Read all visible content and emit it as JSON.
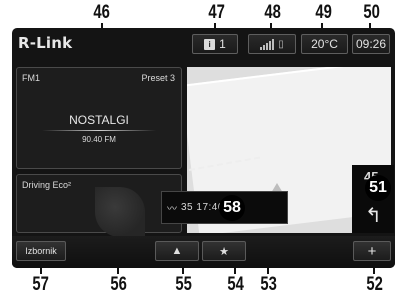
{
  "callouts": {
    "n46": "46",
    "n47": "47",
    "n48": "48",
    "n49": "49",
    "n50": "50",
    "n51": "51",
    "n52": "52",
    "n53": "53",
    "n54": "54",
    "n55": "55",
    "n56": "56",
    "n57": "57",
    "n58": "58"
  },
  "header": {
    "brand": "R-Link",
    "messages_count": "1",
    "temperature": "20°C",
    "time": "09:26"
  },
  "radio": {
    "band": "FM1",
    "preset": "Preset 3",
    "station": "NOSTALGI",
    "frequency": "90.40 FM"
  },
  "eco": {
    "label": "Driving Eco²"
  },
  "navigation": {
    "next_turn_distance": "45",
    "next_turn_icon": "turn-left-arrow",
    "eta_text": "35  17:40"
  },
  "bottom": {
    "menu_label": "Izbornik",
    "nav_icon": "navigation-arrow-icon",
    "favorite_icon": "star-icon",
    "add_icon": "plus-icon"
  }
}
